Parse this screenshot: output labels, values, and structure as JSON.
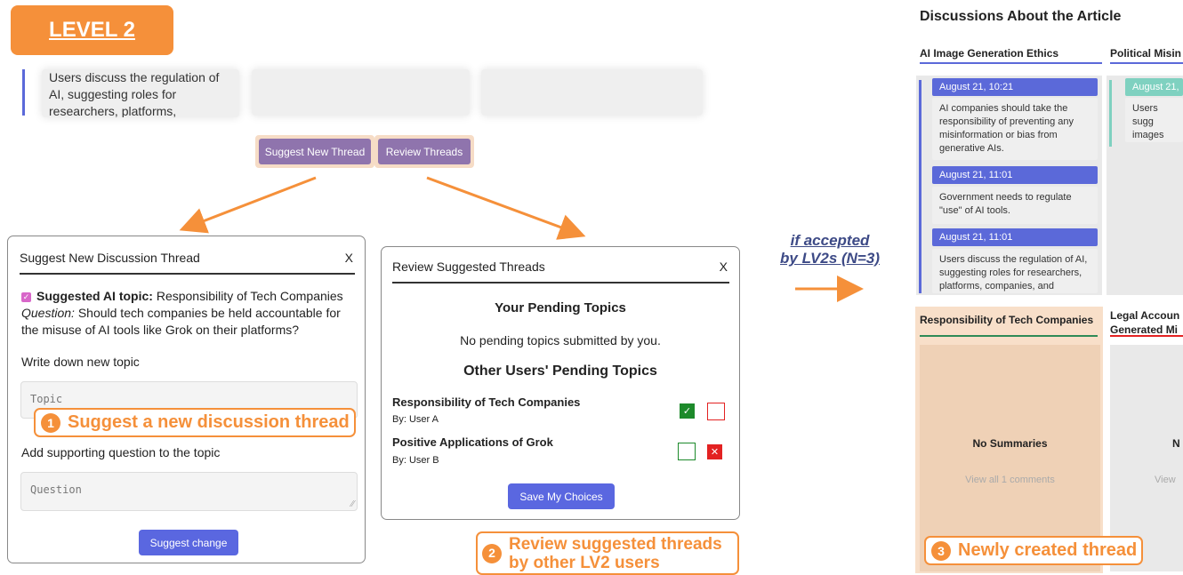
{
  "level_badge": "LEVEL 2",
  "top_card_text": "Users discuss the regulation of AI, suggesting roles for researchers, platforms, companies, and",
  "top_buttons": {
    "suggest": "Suggest New Thread",
    "review": "Review Threads"
  },
  "suggest_modal": {
    "title": "Suggest New Discussion Thread",
    "close": "X",
    "topic_label": "Suggested AI topic:",
    "topic_value": "Responsibility of Tech Companies",
    "question_label": "Question:",
    "question_value": "Should tech companies be held accountable for the misuse of AI tools like Grok on their platforms?",
    "write_topic_label": "Write down new topic",
    "topic_placeholder": "Topic",
    "supporting_label": "Add supporting question to the topic",
    "question_placeholder": "Question",
    "submit": "Suggest change"
  },
  "review_modal": {
    "title": "Review Suggested Threads",
    "close": "X",
    "pending_heading": "Your Pending Topics",
    "pending_empty": "No pending topics submitted by you.",
    "others_heading": "Other Users' Pending Topics",
    "items": [
      {
        "topic": "Responsibility of Tech Companies",
        "by": "By: User A",
        "accepted": true
      },
      {
        "topic": "Positive Applications of Grok",
        "by": "By: User B",
        "accepted": false
      }
    ],
    "save": "Save My Choices"
  },
  "callouts": {
    "one_num": "1",
    "one": "Suggest a new discussion thread",
    "two_num": "2",
    "two_line1": "Review suggested threads",
    "two_line2": "by other LV2 users",
    "three_num": "3",
    "three": "Newly created thread"
  },
  "accepted_note": {
    "line1": "if accepted",
    "line2": "by LV2s (N=3)"
  },
  "discussions": {
    "title": "Discussions About the Article",
    "col1": "AI Image Generation Ethics",
    "col2": "Political Misin",
    "messages": [
      {
        "date": "August 21, 10:21",
        "text": "AI companies should take the responsibility of preventing any misinformation or bias from generative AIs."
      },
      {
        "date": "August 21, 11:01",
        "text": "Government needs to regulate \"use\" of AI tools."
      },
      {
        "date": "August 21, 11:01",
        "text": "Users discuss the regulation of AI, suggesting roles for researchers, platforms, companies, and"
      }
    ],
    "col2_date": "August 21,",
    "col2_text": "Users sugg images wh about bypa",
    "col3": "Responsibility of Tech Companies",
    "col4_line1": "Legal Accoun",
    "col4_line2": "Generated Mi",
    "no_summaries": "No Summaries",
    "no_summaries_cut": "N",
    "view_all": "View all 1 comments",
    "view_cut": "View"
  },
  "colors": {
    "accent": "#f5903a",
    "blue": "#5b69d9",
    "purple": "#8f74ad",
    "teal": "#7fd1c0"
  }
}
